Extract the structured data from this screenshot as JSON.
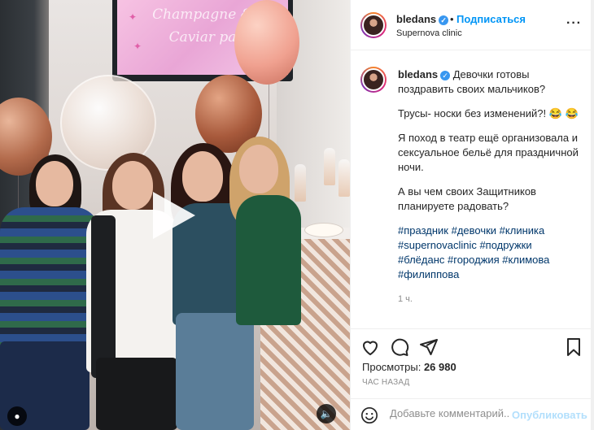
{
  "media": {
    "screen_line1": "Champagne &",
    "screen_line2": "Caviar pa",
    "play_icon": "play-icon",
    "user_tag_icon": "user-icon",
    "sound_icon": "speaker-muted-icon"
  },
  "header": {
    "username": "bledans",
    "verified_icon": "verified-badge-icon",
    "separator": "•",
    "follow_label": "Подписаться",
    "location": "Supernova clinic",
    "more_label": "···"
  },
  "caption": {
    "username": "bledans",
    "line1": "Девочки готовы поздравить своих мальчиков?",
    "line2": "Трусы- носки без изменений?! 😂 😂",
    "line3": "Я поход в театр ещё организовала и сексуальное бельё для праздничной ночи.",
    "line4": "А вы чем своих Защитников планируете радовать?",
    "hashtags_line1": "#праздник #девочки #клиника",
    "hashtags_line2": "#supernovaclinic #подружки",
    "hashtags_line3": "#блёданс #городжия #климова",
    "hashtags_line4": "#филиппова",
    "time": "1 ч."
  },
  "actions": {
    "like_icon": "heart-icon",
    "comment_icon": "comment-icon",
    "share_icon": "send-icon",
    "save_icon": "bookmark-icon"
  },
  "stats": {
    "views_label": "Просмотры:",
    "views_value": "26 980",
    "time_ago": "ЧАС НАЗАД"
  },
  "comment": {
    "placeholder": "Добавьте комментарий...",
    "publish_label": "Опубликовать",
    "emoji_icon": "smiley-icon"
  },
  "colors": {
    "accent": "#0095f6",
    "publish_disabled": "#b2dffc",
    "hashtag": "#00376b"
  }
}
